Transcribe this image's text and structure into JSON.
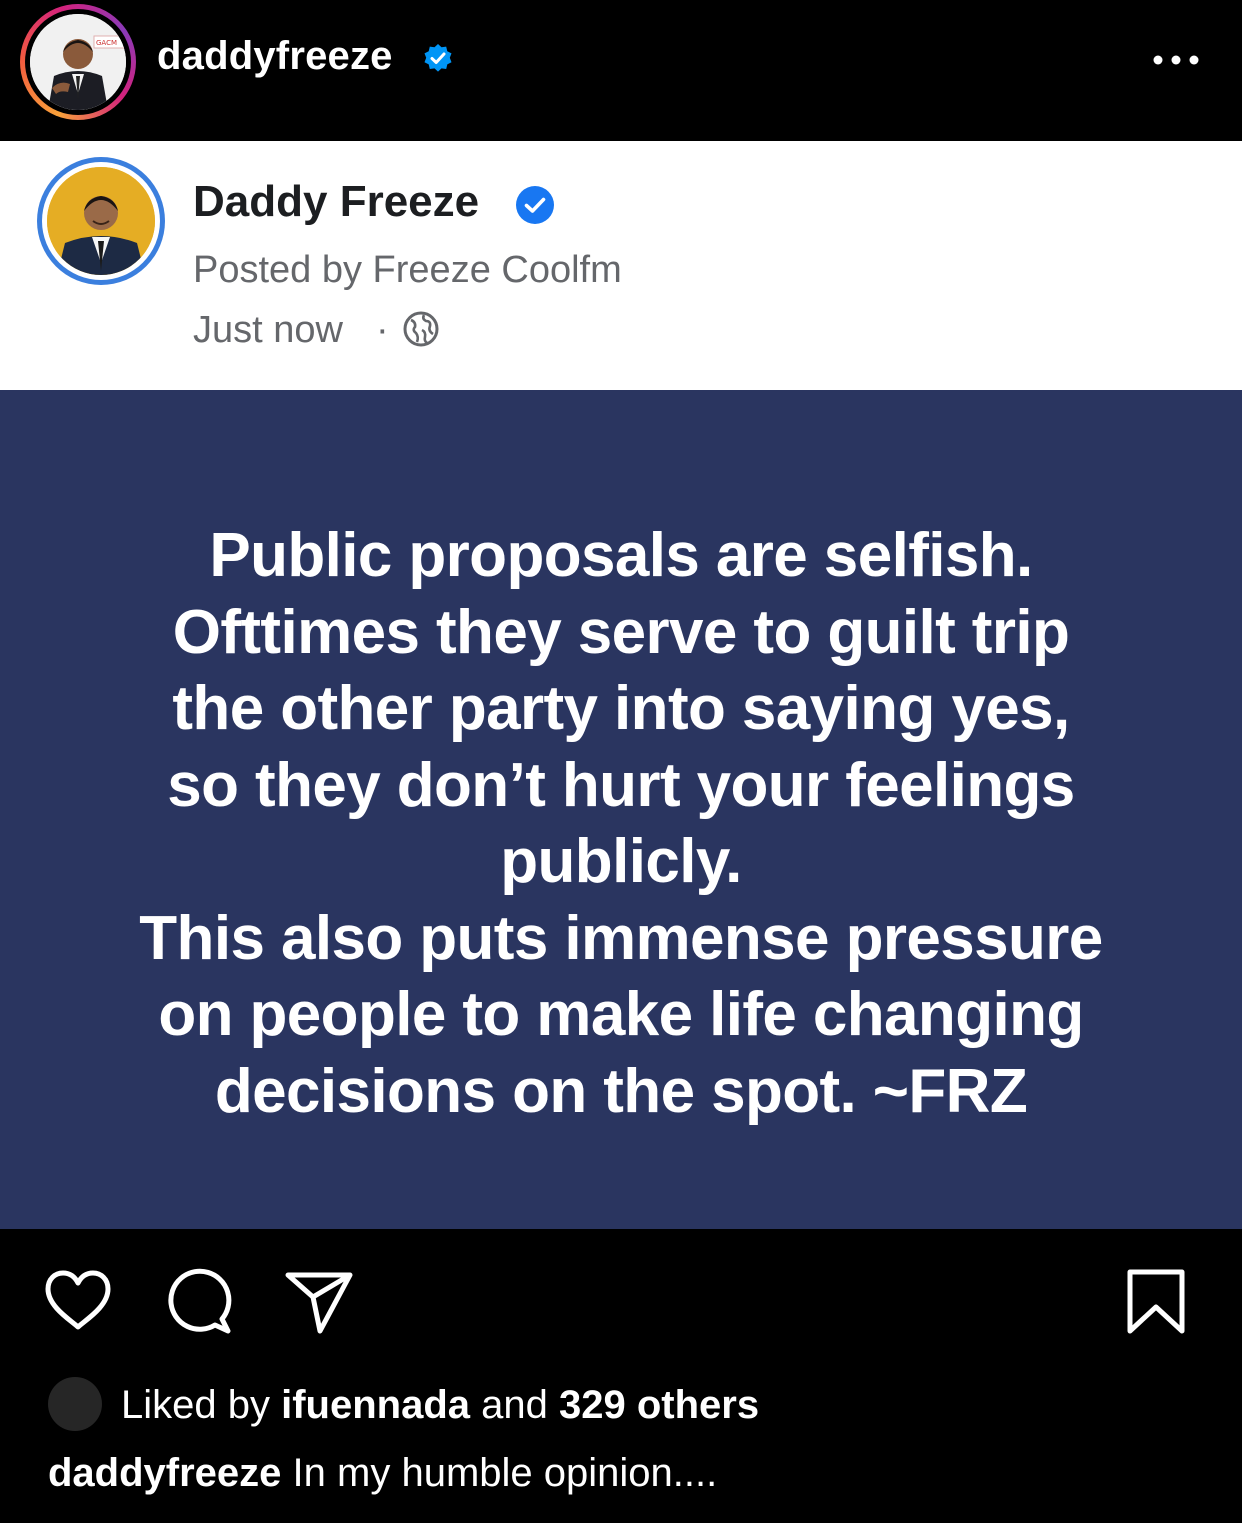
{
  "instagram": {
    "username": "daddyfreeze",
    "verified_icon": "verified-badge-icon",
    "more_icon": "more-horizontal-icon"
  },
  "facebook_post": {
    "name": "Daddy Freeze",
    "posted_by": "Posted by Freeze Coolfm",
    "time": "Just now",
    "separator": "·",
    "privacy_icon": "globe-icon",
    "quote": "Public proposals are selfish.\nOfttimes they serve to guilt trip\nthe other party into saying yes,\nso they don’t hurt your feelings\npublicly.\nThis also puts immense pressure\non people to make life changing\ndecisions on the spot. ~FRZ"
  },
  "actions": {
    "like_icon": "heart-icon",
    "comment_icon": "comment-icon",
    "share_icon": "send-icon",
    "save_icon": "bookmark-icon"
  },
  "likes": {
    "prefix": "Liked by",
    "user": "ifuennada",
    "middle": "and",
    "others": "329 others"
  },
  "caption": {
    "username": "daddyfreeze",
    "text": "In my humble opinion...."
  },
  "colors": {
    "instagram_bg": "#000000",
    "card_bg": "#ffffff",
    "quote_bg": "#2a3560",
    "verified_blue": "#0095f6",
    "facebook_blue": "#1877f2",
    "secondary_text": "#65676b"
  }
}
